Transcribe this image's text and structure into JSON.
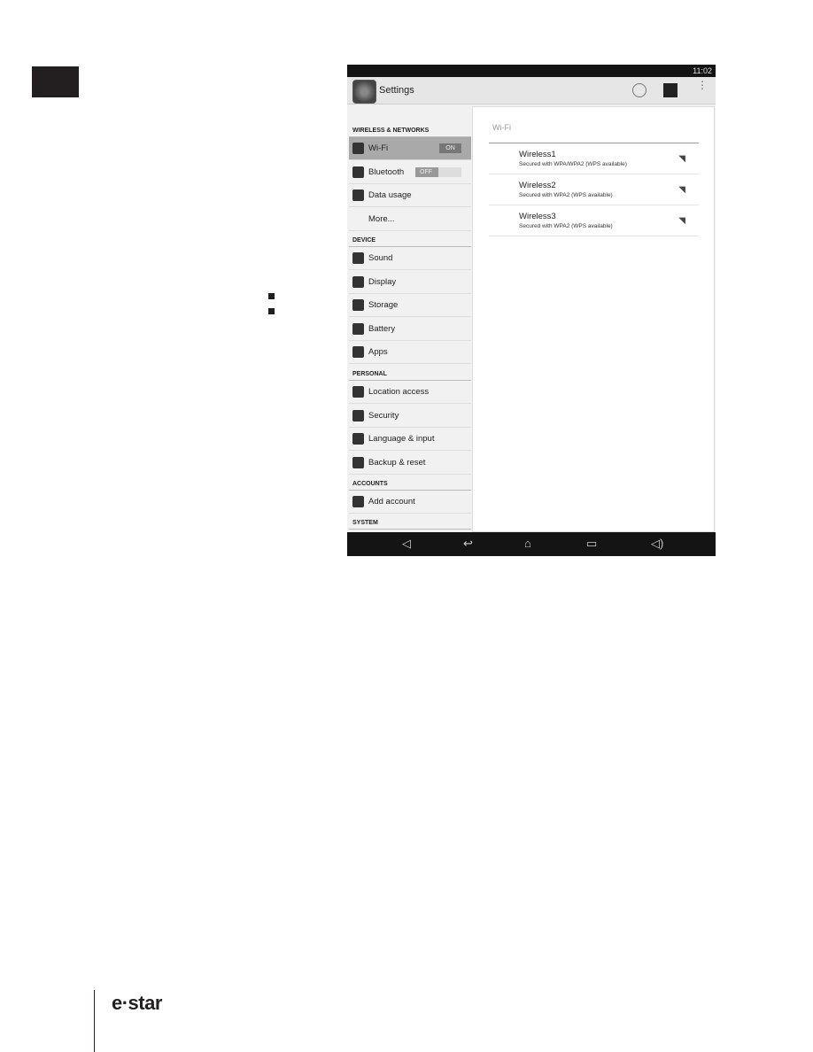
{
  "status_bar": {
    "time": "11:02"
  },
  "action_bar": {
    "title": "Settings",
    "icons": [
      "settings-app-icon",
      "sync-icon",
      "account-icon",
      "overflow-menu-icon"
    ]
  },
  "sidebar": {
    "sections": [
      {
        "header": "WIRELESS & NETWORKS",
        "items": [
          {
            "label": "Wi-Fi",
            "toggle": "ON",
            "selected": true
          },
          {
            "label": "Bluetooth",
            "toggle": "OFF"
          },
          {
            "label": "Data usage"
          },
          {
            "label": "More..."
          }
        ]
      },
      {
        "header": "DEVICE",
        "items": [
          {
            "label": "Sound"
          },
          {
            "label": "Display"
          },
          {
            "label": "Storage"
          },
          {
            "label": "Battery"
          },
          {
            "label": "Apps"
          }
        ]
      },
      {
        "header": "PERSONAL",
        "items": [
          {
            "label": "Location access"
          },
          {
            "label": "Security"
          },
          {
            "label": "Language & input"
          },
          {
            "label": "Backup & reset"
          }
        ]
      },
      {
        "header": "ACCOUNTS",
        "items": [
          {
            "label": "Add account"
          }
        ]
      },
      {
        "header": "SYSTEM",
        "items": []
      }
    ]
  },
  "wifi_panel": {
    "title": "Wi-Fi",
    "networks": [
      {
        "name": "Wireless1",
        "security": "Secured with WPA/WPA2 (WPS available)"
      },
      {
        "name": "Wireless2",
        "security": "Secured with WPA2 (WPS available)"
      },
      {
        "name": "Wireless3",
        "security": "Secured with WPA2 (WPS available)"
      }
    ]
  },
  "nav_bar": {
    "icons": [
      "volume-down-icon",
      "back-icon",
      "home-icon",
      "recents-icon",
      "volume-up-icon"
    ]
  },
  "footer": {
    "logo": "e-star"
  }
}
